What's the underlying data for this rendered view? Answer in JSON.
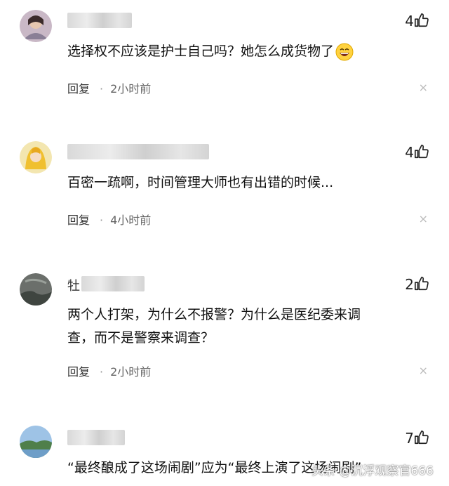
{
  "comments": [
    {
      "username_visible": "",
      "likes": "4",
      "text": "选择权不应该是护士自己吗？她怎么成货物了",
      "reply_label": "回复",
      "time": "2小时前"
    },
    {
      "username_visible": "",
      "likes": "4",
      "text": "百密一疏啊，时间管理大师也有出错的时候...",
      "reply_label": "回复",
      "time": "4小时前"
    },
    {
      "username_visible": "牡",
      "likes": "2",
      "text_line1": "两个人打架，为什么不报警？为什么是医纪委来调",
      "text_line2": "查，而不是警察来调查？",
      "reply_label": "回复",
      "time": "2小时前"
    },
    {
      "username_visible": "",
      "likes": "7",
      "text": "“最终酿成了这场闹剧”应为“最终上演了这场闹剧”"
    }
  ],
  "close_glyph": "×",
  "dot_glyph": "·",
  "watermark": "头条 @沉浮观察官666",
  "icons": [
    "avatar",
    "thumbs-up-icon",
    "close-icon",
    "grin-emoji-icon"
  ]
}
